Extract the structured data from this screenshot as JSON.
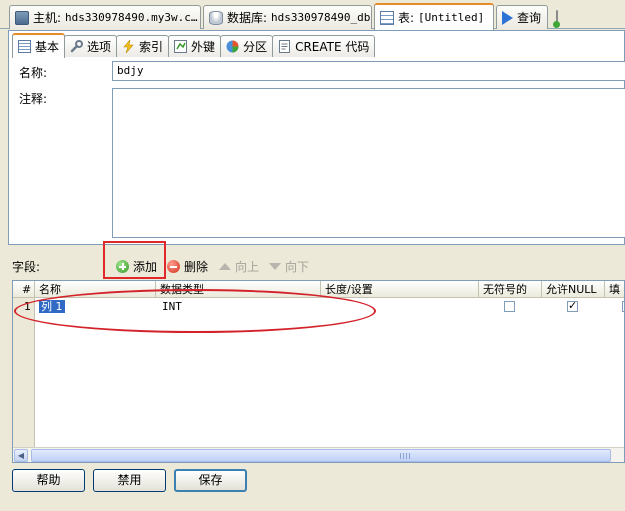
{
  "doc_tabs": [
    {
      "label": "主机:",
      "value": "hds330978490.my3w.c…",
      "icon": "host-icon"
    },
    {
      "label": "数据库:",
      "value": "hds330978490_db",
      "icon": "database-icon"
    },
    {
      "label": "表:",
      "value": "[Untitled]",
      "icon": "table-icon"
    },
    {
      "label": "查询",
      "value": "",
      "icon": "play-icon"
    }
  ],
  "sub_tabs": [
    {
      "label": "基本",
      "icon": "table-icon"
    },
    {
      "label": "选项",
      "icon": "wrench-icon"
    },
    {
      "label": "索引",
      "icon": "lightning-icon"
    },
    {
      "label": "外键",
      "icon": "foreign-key-icon"
    },
    {
      "label": "分区",
      "icon": "pie-icon"
    },
    {
      "label": "CREATE 代码",
      "icon": "code-icon"
    }
  ],
  "form": {
    "name_label": "名称:",
    "name_value": "bdjy",
    "comment_label": "注释:",
    "comment_value": ""
  },
  "fields_toolbar": {
    "label": "字段:",
    "add": "添加",
    "delete": "删除",
    "up": "向上",
    "down": "向下"
  },
  "grid": {
    "columns": [
      "#",
      "名称",
      "数据类型",
      "长度/设置",
      "无符号的",
      "允许NULL",
      "填"
    ],
    "rows": [
      {
        "num": "1",
        "name": "列 1",
        "type": "INT",
        "length": "",
        "unsigned": false,
        "allow_null": true
      }
    ]
  },
  "buttons": {
    "help": "帮助",
    "disable": "禁用",
    "save": "保存"
  },
  "colors": {
    "annotation_red": "#E0282A",
    "tab_accent": "#E68B2C",
    "selection": "#316AC5"
  }
}
